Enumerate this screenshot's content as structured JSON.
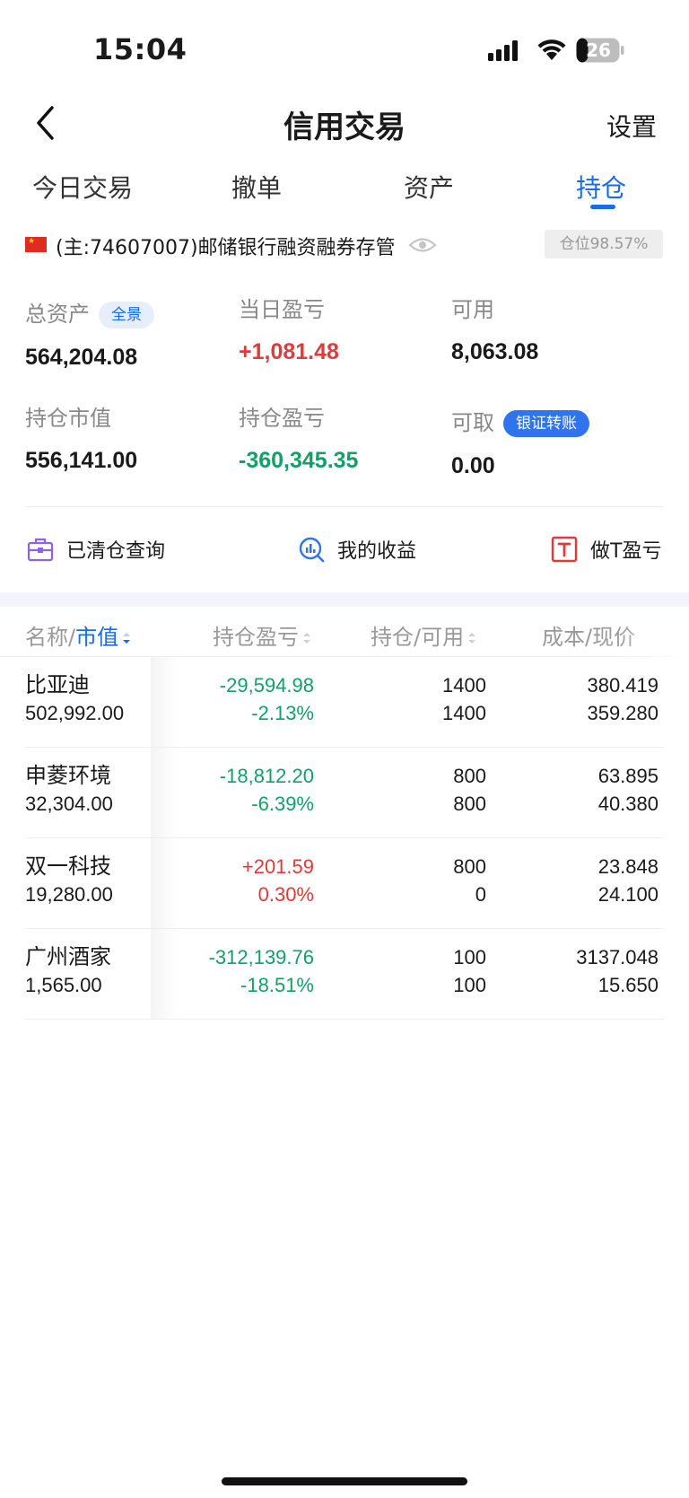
{
  "status_bar": {
    "time": "15:04",
    "battery": "26"
  },
  "nav": {
    "title": "信用交易",
    "settings_label": "设置"
  },
  "tabs": [
    {
      "label": "今日交易",
      "active": false
    },
    {
      "label": "撤单",
      "active": false
    },
    {
      "label": "资产",
      "active": false
    },
    {
      "label": "持仓",
      "active": true
    }
  ],
  "account": {
    "text": "(主:74607007)邮储银行融资融券存管",
    "position_badge": "仓位98.57%"
  },
  "stats": {
    "total_assets": {
      "label": "总资产",
      "value": "564,204.08",
      "pill": "全景"
    },
    "daily_pl": {
      "label": "当日盈亏",
      "value": "+1,081.48"
    },
    "available": {
      "label": "可用",
      "value": "8,063.08"
    },
    "market_value": {
      "label": "持仓市值",
      "value": "556,141.00"
    },
    "position_pl": {
      "label": "持仓盈亏",
      "value": "-360,345.35"
    },
    "withdrawable": {
      "label": "可取",
      "value": "0.00",
      "pill": "银证转账"
    }
  },
  "quick_links": [
    {
      "label": "已清仓查询",
      "icon": "briefcase-icon"
    },
    {
      "label": "我的收益",
      "icon": "chart-search-icon"
    },
    {
      "label": "做T盈亏",
      "icon": "t-box-icon"
    }
  ],
  "table": {
    "headers": {
      "name_prefix": "名称/",
      "name_sort": "市值",
      "pl": "持仓盈亏",
      "position": "持仓/可用",
      "cost": "成本/现价"
    },
    "rows": [
      {
        "name": "比亚迪",
        "market_value": "502,992.00",
        "pl": "-29,594.98",
        "pl_pct": "-2.13%",
        "position": "1400",
        "available": "1400",
        "cost": "380.419",
        "price": "359.280",
        "trend": "down"
      },
      {
        "name": "申菱环境",
        "market_value": "32,304.00",
        "pl": "-18,812.20",
        "pl_pct": "-6.39%",
        "position": "800",
        "available": "800",
        "cost": "63.895",
        "price": "40.380",
        "trend": "down"
      },
      {
        "name": "双一科技",
        "market_value": "19,280.00",
        "pl": "+201.59",
        "pl_pct": "0.30%",
        "position": "800",
        "available": "0",
        "cost": "23.848",
        "price": "24.100",
        "trend": "up"
      },
      {
        "name": "广州酒家",
        "market_value": "1,565.00",
        "pl": "-312,139.76",
        "pl_pct": "-18.51%",
        "position": "100",
        "available": "100",
        "cost": "3137.048",
        "price": "15.650",
        "trend": "down"
      }
    ]
  },
  "colors": {
    "accent": "#1a6bea",
    "up": "#e03a3a",
    "down": "#12a068"
  }
}
